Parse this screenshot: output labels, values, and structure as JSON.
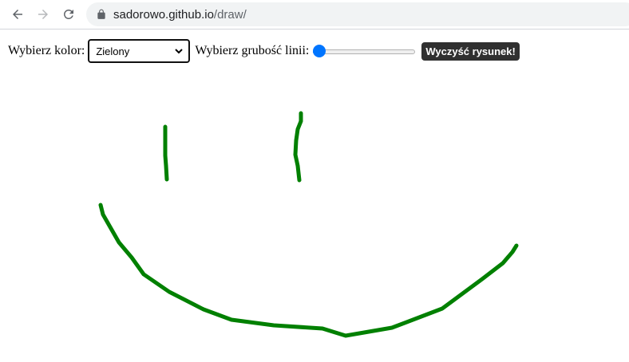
{
  "browser": {
    "url_host": "sadorowo.github.io",
    "url_path": "/draw/",
    "icons": {
      "back": "arrow-left-icon",
      "forward": "arrow-right-icon",
      "reload": "reload-icon",
      "lock": "lock-icon"
    }
  },
  "toolbar": {
    "color_label": "Wybierz kolor:",
    "color_selected": "Zielony",
    "width_label": "Wybierz grubość linii:",
    "width_slider_fraction": 0.0,
    "clear_button_label": "Wyczyść rysunek!"
  },
  "drawing": {
    "stroke_color": "#008000"
  },
  "colors": {
    "slider_accent": "#0075ff",
    "button_bg": "#303030"
  }
}
